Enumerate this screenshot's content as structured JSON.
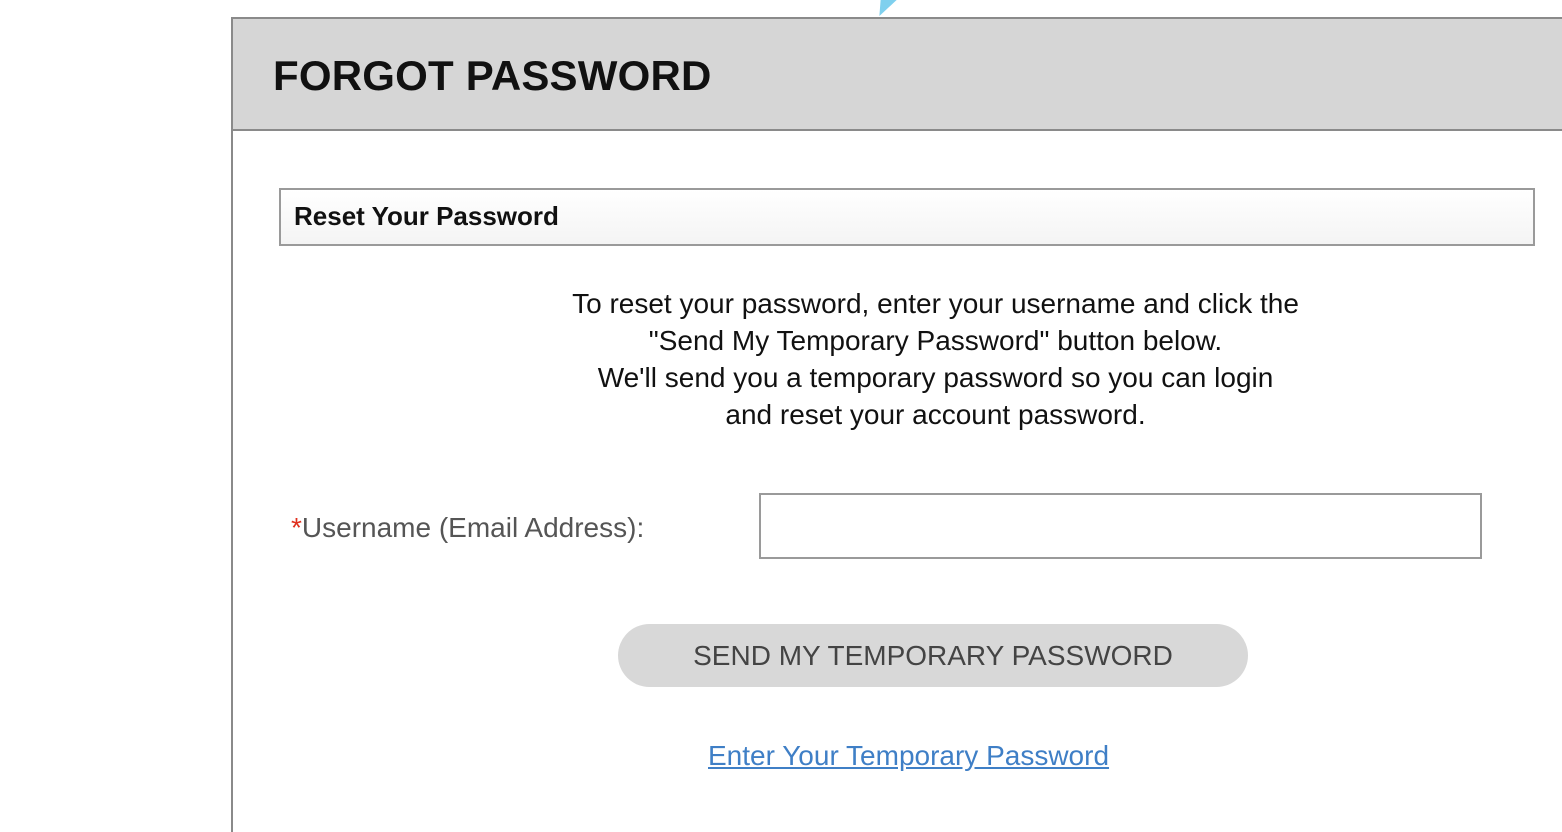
{
  "header": {
    "title": "FORGOT PASSWORD"
  },
  "section": {
    "title": "Reset Your Password"
  },
  "instructions": [
    "To reset your password, enter your username and click the",
    "\"Send My Temporary Password\" button below.",
    "We'll send you a temporary password so you can login",
    "and reset your account password."
  ],
  "form": {
    "required_marker": "*",
    "username_label": "Username (Email Address):",
    "username_value": "",
    "submit_label": "SEND MY TEMPORARY PASSWORD"
  },
  "links": {
    "temporary_password": "Enter Your Temporary Password"
  },
  "colors": {
    "header_bg": "#d6d6d6",
    "required": "#e0301e",
    "link": "#3f7fc6",
    "button_bg": "#d8d8d8"
  }
}
